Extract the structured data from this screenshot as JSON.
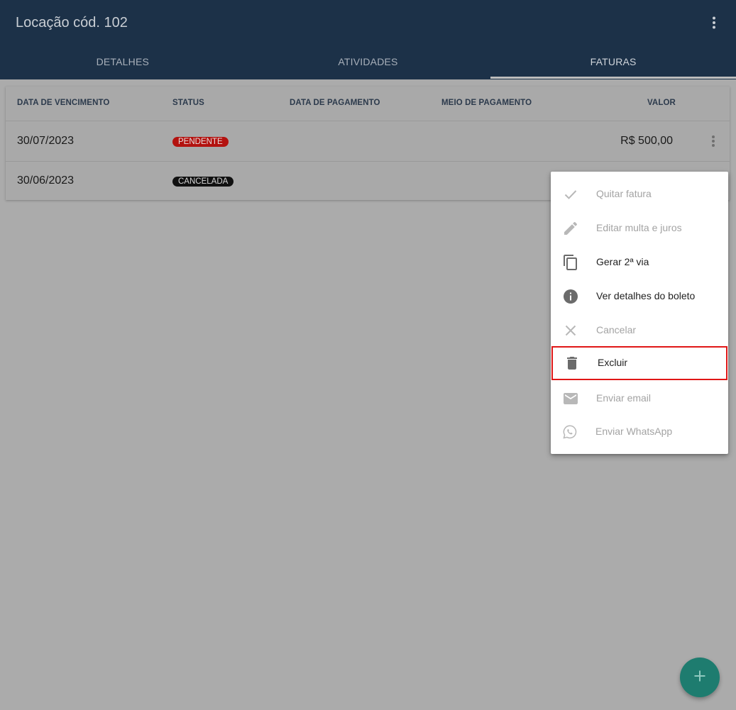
{
  "header": {
    "title": "Locação cód. 102",
    "menu_icon": "more-vert-icon"
  },
  "tabs": [
    {
      "label": "DETALHES",
      "active": false
    },
    {
      "label": "ATIVIDADES",
      "active": false
    },
    {
      "label": "FATURAS",
      "active": true
    }
  ],
  "table": {
    "headers": [
      "DATA DE VENCIMENTO",
      "STATUS",
      "DATA DE PAGAMENTO",
      "MEIO DE PAGAMENTO",
      "VALOR"
    ],
    "rows": [
      {
        "due_date": "30/07/2023",
        "status": "PENDENTE",
        "payment_date": "",
        "payment_method": "",
        "value": "R$ 500,00"
      },
      {
        "due_date": "30/06/2023",
        "status": "CANCELADA",
        "payment_date": "",
        "payment_method": "",
        "value": ""
      }
    ]
  },
  "context_menu": {
    "items": [
      {
        "label": "Quitar fatura",
        "icon": "check-icon",
        "enabled": false
      },
      {
        "label": "Editar multa e juros",
        "icon": "pencil-icon",
        "enabled": false
      },
      {
        "label": "Gerar 2ª via",
        "icon": "copy-icon",
        "enabled": true
      },
      {
        "label": "Ver detalhes do boleto",
        "icon": "info-icon",
        "enabled": true
      },
      {
        "label": "Cancelar",
        "icon": "close-icon",
        "enabled": false
      },
      {
        "label": "Excluir",
        "icon": "trash-icon",
        "enabled": true,
        "highlighted": true
      },
      {
        "label": "Enviar email",
        "icon": "email-icon",
        "enabled": false
      },
      {
        "label": "Enviar WhatsApp",
        "icon": "whatsapp-icon",
        "enabled": false
      }
    ]
  },
  "fab": {
    "icon": "plus-icon"
  },
  "colors": {
    "appbar": "#1c3148",
    "backdrop": "#ababab",
    "badge_pending": "#b3120f",
    "badge_cancelled": "#111111",
    "highlight_border": "#e01717",
    "fab": "#1e7c6f"
  }
}
